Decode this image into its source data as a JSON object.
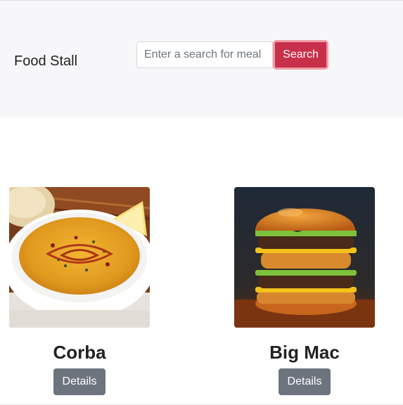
{
  "navbar": {
    "brand": "Food Stall",
    "search": {
      "placeholder": "Enter a search for meal ..",
      "value": "",
      "button_label": "Search"
    }
  },
  "meals": [
    {
      "name": "Corba",
      "details_label": "Details",
      "image": "lentil-soup-bowl"
    },
    {
      "name": "Big Mac",
      "details_label": "Details",
      "image": "double-cheeseburger"
    }
  ],
  "colors": {
    "navbar_bg": "#f7f7fa",
    "search_button": "#c82f4a",
    "details_button": "#6c757d"
  }
}
